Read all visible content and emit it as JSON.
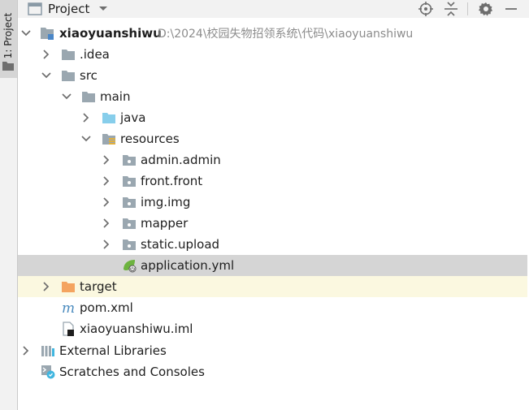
{
  "toolwindow": {
    "stripe_label": "1: Project"
  },
  "header": {
    "title": "Project"
  },
  "tree": [
    {
      "label": "xiaoyuanshiwu",
      "path": "D:\\2024\\校园失物招领系统\\代码\\xiaoyuanshiwu",
      "icon": "module-folder-icon",
      "expanded": true
    },
    {
      "label": ".idea",
      "icon": "folder-icon",
      "expanded": false
    },
    {
      "label": "src",
      "icon": "folder-icon",
      "expanded": true
    },
    {
      "label": "main",
      "icon": "folder-icon",
      "expanded": true
    },
    {
      "label": "java",
      "icon": "source-folder-icon",
      "expanded": false
    },
    {
      "label": "resources",
      "icon": "resources-folder-icon",
      "expanded": true
    },
    {
      "label": "admin.admin",
      "icon": "package-icon",
      "expanded": false
    },
    {
      "label": "front.front",
      "icon": "package-icon",
      "expanded": false
    },
    {
      "label": "img.img",
      "icon": "package-icon",
      "expanded": false
    },
    {
      "label": "mapper",
      "icon": "package-icon",
      "expanded": false
    },
    {
      "label": "static.upload",
      "icon": "package-icon",
      "expanded": false
    },
    {
      "label": "application.yml",
      "icon": "spring-yml-icon",
      "selected": true
    },
    {
      "label": "target",
      "icon": "excluded-folder-icon",
      "expanded": false,
      "highlight": true
    },
    {
      "label": "pom.xml",
      "icon": "maven-icon"
    },
    {
      "label": "xiaoyuanshiwu.iml",
      "icon": "iml-file-icon"
    },
    {
      "label": "External Libraries",
      "icon": "libraries-icon",
      "expanded": false
    },
    {
      "label": "Scratches and Consoles",
      "icon": "scratches-icon"
    }
  ],
  "colors": {
    "folder": "#9aa7b0",
    "source_folder": "#87ceeb",
    "excluded_folder": "#f4a460",
    "selection": "#d5d5d5",
    "highlight": "#fbf8e0",
    "maven": "#4b8bbe",
    "spring": "#6db33f"
  }
}
